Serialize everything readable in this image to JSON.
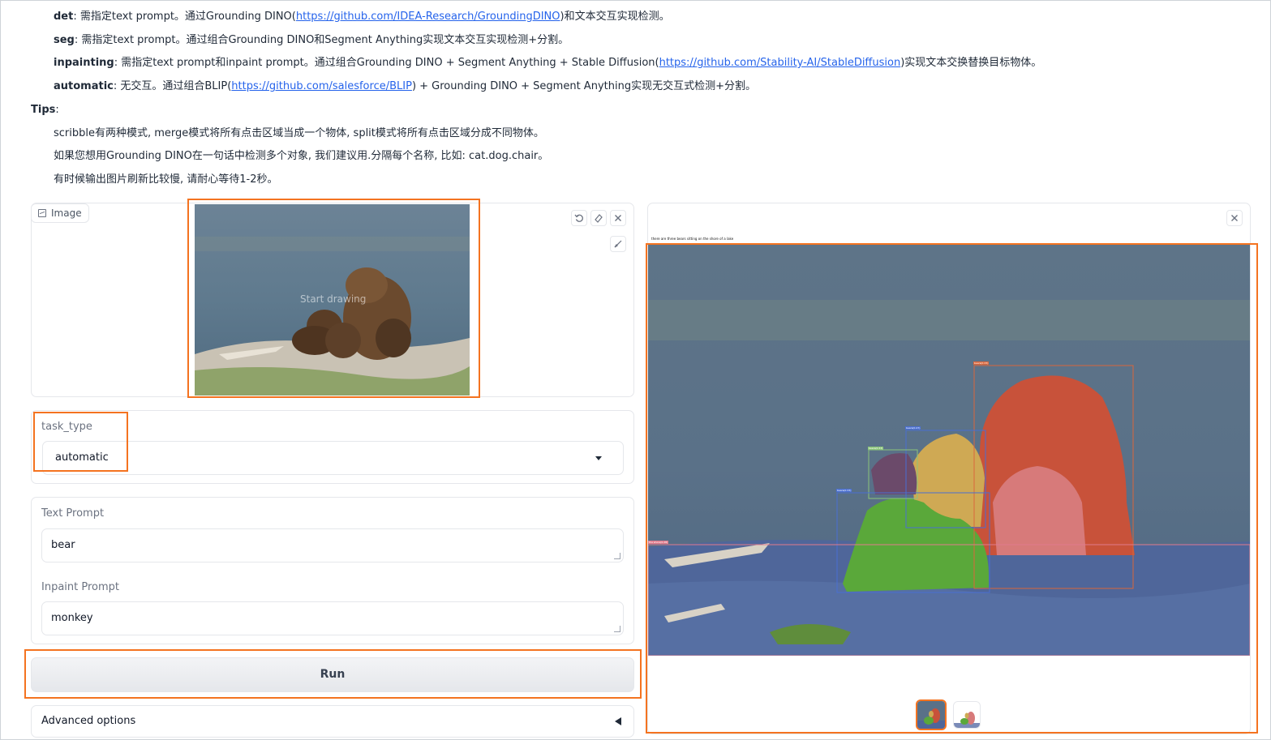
{
  "intro": {
    "det": {
      "key": "det",
      "text_a": ": 需指定text prompt。通过Grounding DINO(",
      "link": "https://github.com/IDEA-Research/GroundingDINO",
      "text_b": ")和文本交互实现检测。"
    },
    "seg": {
      "key": "seg",
      "text": ": 需指定text prompt。通过组合Grounding DINO和Segment Anything实现文本交互实现检测+分割。"
    },
    "inpainting": {
      "key": "inpainting",
      "text_a": ": 需指定text prompt和inpaint prompt。通过组合Grounding DINO + Segment Anything + Stable Diffusion(",
      "link": "https://github.com/Stability-AI/StableDiffusion",
      "text_b": ")实现文本交换替换目标物体。"
    },
    "automatic": {
      "key": "automatic",
      "text_a": ": 无交互。通过组合BLIP(",
      "link": "https://github.com/salesforce/BLIP",
      "text_b": ") + Grounding DINO + Segment Anything实现无交互式检测+分割。"
    },
    "tips_title": "Tips",
    "tips": [
      "scribble有两种模式, merge模式将所有点击区域当成一个物体, split模式将所有点击区域分成不同物体。",
      "如果您想用Grounding DINO在一句话中检测多个对象, 我们建议用.分隔每个名称, 比如: cat.dog.chair。",
      "有时候输出图片刷新比较慢, 请耐心等待1-2秒。"
    ]
  },
  "image_input": {
    "label": "Image",
    "canvas_hint": "Start drawing"
  },
  "task_type": {
    "label": "task_type",
    "value": "automatic"
  },
  "text_prompt": {
    "label": "Text Prompt",
    "value": "bear"
  },
  "inpaint_prompt": {
    "label": "Inpaint Prompt",
    "value": "monkey"
  },
  "run_label": "Run",
  "advanced_label": "Advanced options",
  "result": {
    "caption": "there are three bears sitting on the shore of a lake",
    "boxes": [
      "bears(0.33)",
      "bears(0.47)",
      "bears(0.33)",
      "bears(0.33)",
      "the shore(0.28)"
    ]
  },
  "colors": {
    "accent": "#f47320",
    "link": "#2563eb"
  }
}
